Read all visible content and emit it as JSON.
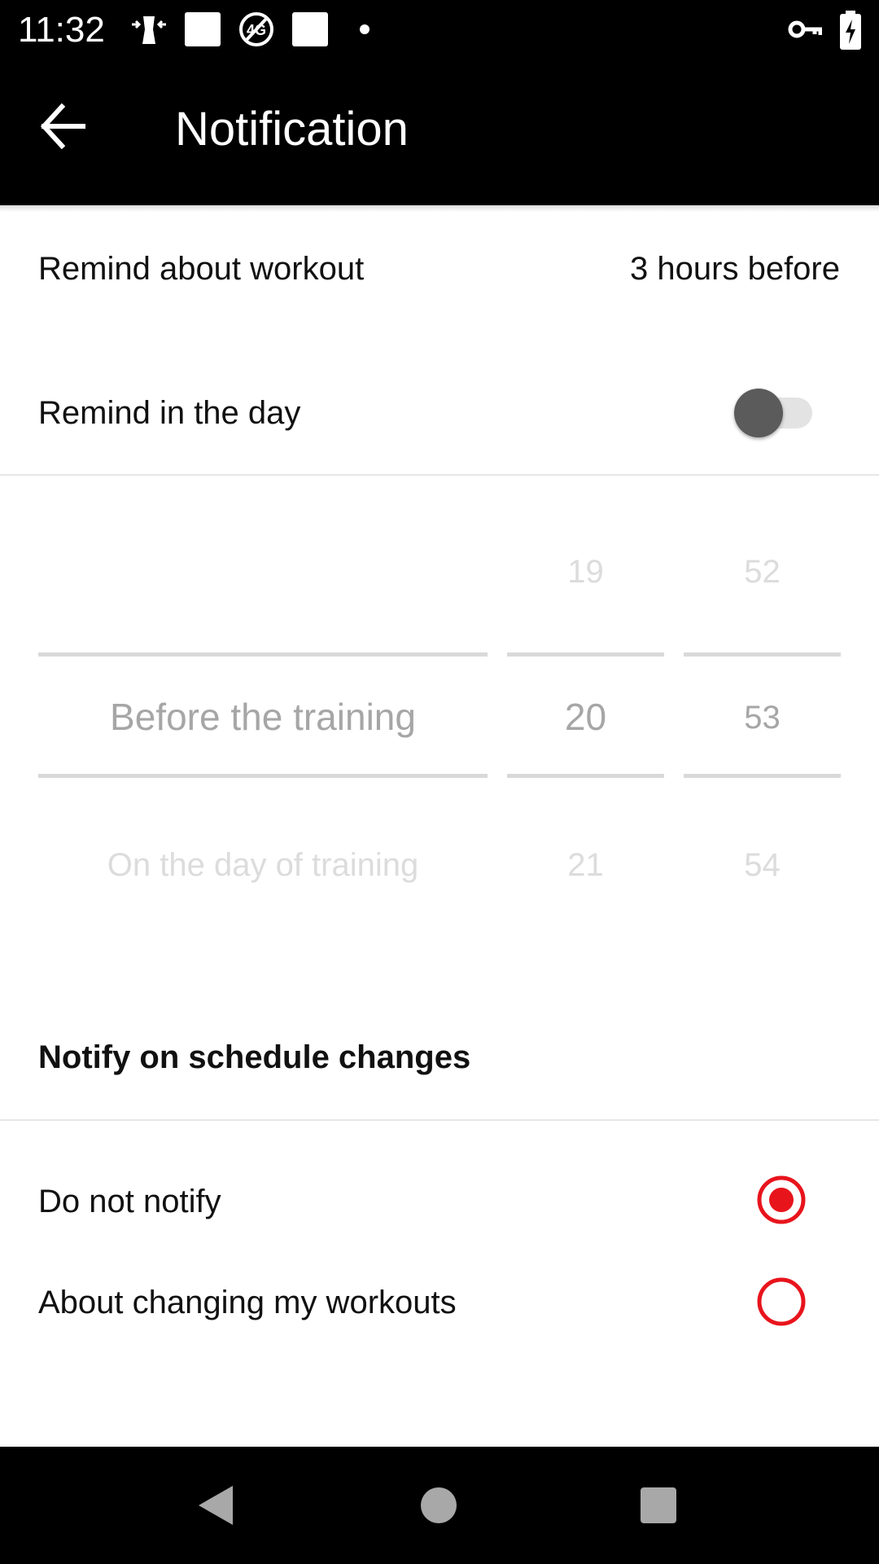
{
  "status_bar": {
    "time": "11:32",
    "icons": [
      "fitness-app-icon",
      "square-notification-icon",
      "no-4g-icon",
      "square-notification-icon",
      "dot-icon",
      "vpn-key-icon",
      "battery-charging-icon"
    ]
  },
  "app_bar": {
    "title": "Notification",
    "back_icon": "arrow-left-icon"
  },
  "settings": {
    "remind_workout": {
      "label": "Remind about workout",
      "value": "3 hours before"
    },
    "remind_day": {
      "label": "Remind in the day",
      "enabled": false
    }
  },
  "picker": {
    "mode": {
      "prev": "",
      "selected": "Before the training",
      "next": "On the day of training"
    },
    "hour": {
      "prev": "19",
      "selected": "20",
      "next": "21"
    },
    "minute": {
      "prev": "52",
      "selected": "53",
      "next": "54"
    }
  },
  "schedule_changes": {
    "title": "Notify on schedule changes",
    "options": [
      {
        "label": "Do not notify",
        "selected": true
      },
      {
        "label": "About changing my workouts",
        "selected": false
      }
    ]
  },
  "colors": {
    "accent": "#e8141c",
    "bar_background": "#000000",
    "toggle_thumb": "#5b5b5b",
    "toggle_track": "#e3e3e3"
  },
  "nav_bar": {
    "icons": [
      "back-triangle-icon",
      "home-circle-icon",
      "recents-square-icon"
    ]
  }
}
